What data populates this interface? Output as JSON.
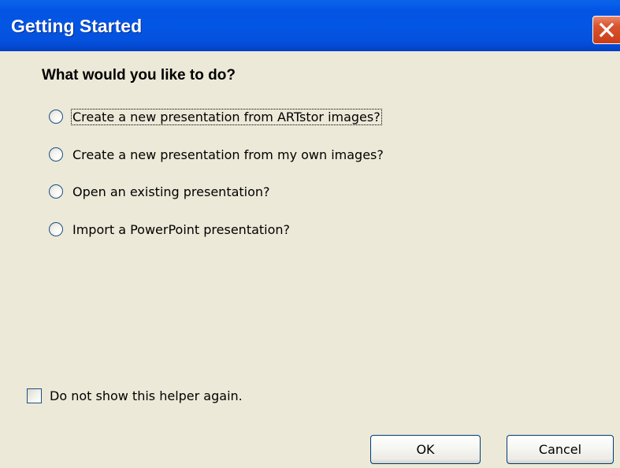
{
  "window": {
    "title": "Getting Started"
  },
  "dialog": {
    "heading": "What would you like to do?",
    "options": [
      {
        "label": "Create a new presentation from ARTstor images?",
        "selected": false,
        "focused": true
      },
      {
        "label": "Create a new presentation from my own images?",
        "selected": false,
        "focused": false
      },
      {
        "label": "Open an existing presentation?",
        "selected": false,
        "focused": false
      },
      {
        "label": "Import a PowerPoint presentation?",
        "selected": false,
        "focused": false
      }
    ],
    "dont_show_again": {
      "label": "Do not show this helper again.",
      "checked": false
    }
  },
  "buttons": {
    "ok_label": "OK",
    "cancel_label": "Cancel"
  },
  "icons": {
    "close": "close-icon"
  },
  "colors": {
    "titlebar": "#0453E2",
    "dialog_background": "#ECE9D8",
    "close_button": "#D9542E"
  }
}
